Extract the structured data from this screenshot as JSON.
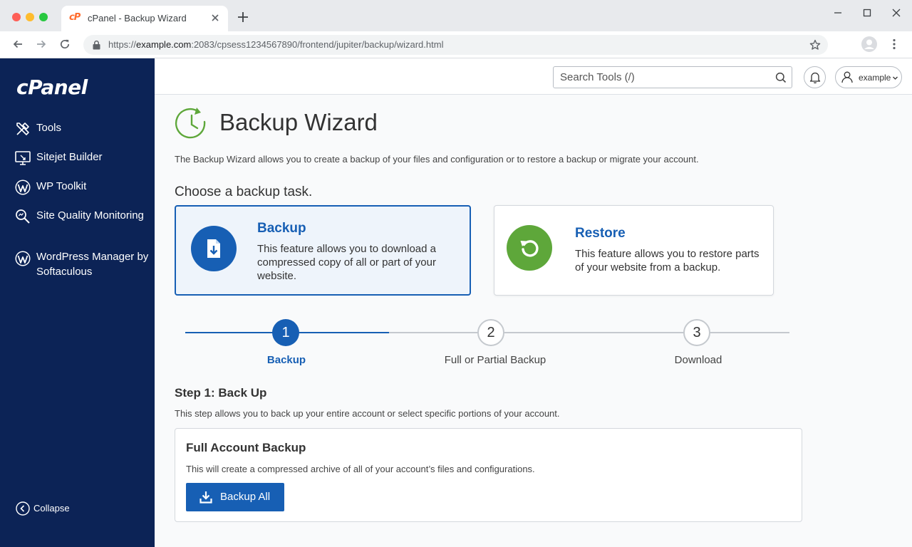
{
  "browser": {
    "tab_title": "cPanel - Backup Wizard",
    "favicon_text": "cP",
    "url_prefix": "https://",
    "url_host": "example.com",
    "url_rest": ":2083/cpsess1234567890/frontend/jupiter/backup/wizard.html"
  },
  "sidebar": {
    "logo": "cPanel",
    "items": [
      {
        "label": "Tools",
        "icon": "tools-icon"
      },
      {
        "label": "Sitejet Builder",
        "icon": "monitor-icon"
      },
      {
        "label": "WP Toolkit",
        "icon": "wordpress-icon"
      },
      {
        "label": "Site Quality Monitoring",
        "icon": "search-icon"
      },
      {
        "label": "WordPress Manager by Softaculous",
        "icon": "wordpress-icon"
      }
    ],
    "collapse_label": "Collapse"
  },
  "header": {
    "search_placeholder": "Search Tools (/)",
    "username": "example"
  },
  "page": {
    "title": "Backup Wizard",
    "intro": "The Backup Wizard allows you to create a backup of your files and configuration or to restore a backup or migrate your account.",
    "choose_label": "Choose a backup task.",
    "cards": {
      "backup": {
        "title": "Backup",
        "description": "This feature allows you to download a compressed copy of all or part of your website."
      },
      "restore": {
        "title": "Restore",
        "description": "This feature allows you to restore parts of your website from a backup."
      }
    },
    "steps": [
      {
        "number": "1",
        "label": "Backup"
      },
      {
        "number": "2",
        "label": "Full or Partial Backup"
      },
      {
        "number": "3",
        "label": "Download"
      }
    ],
    "step_heading": "Step 1: Back Up",
    "step_description": "This step allows you to back up your entire account or select specific portions of your account.",
    "full_backup": {
      "title": "Full Account Backup",
      "description": "This will create a compressed archive of all of your account’s files and configurations.",
      "button_label": "Backup All"
    }
  },
  "colors": {
    "sidebar_bg": "#0c2356",
    "accent_blue": "#175fb4",
    "restore_green": "#5ea73a"
  }
}
